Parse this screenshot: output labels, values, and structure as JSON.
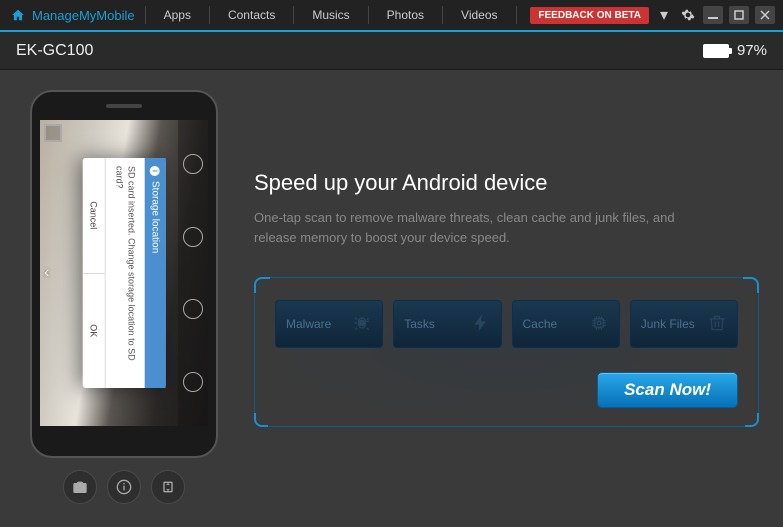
{
  "app_title": "ManageMyMobile",
  "nav": [
    "Apps",
    "Contacts",
    "Musics",
    "Photos",
    "Videos"
  ],
  "feedback_label": "FEEDBACK ON BETA",
  "device": {
    "name": "EK-GC100",
    "battery_pct": "97%"
  },
  "phone_dialog": {
    "title": "Storage location",
    "body": "SD card inserted. Change storage location to SD card?",
    "cancel": "Cancel",
    "ok": "OK"
  },
  "content": {
    "headline": "Speed up your Android device",
    "subtext": "One-tap scan to remove malware threats, clean cache and junk files, and release memory to boost your device speed."
  },
  "tiles": {
    "malware": "Malware",
    "tasks": "Tasks",
    "cache": "Cache",
    "junk": "Junk Files"
  },
  "scan_button": "Scan Now!"
}
